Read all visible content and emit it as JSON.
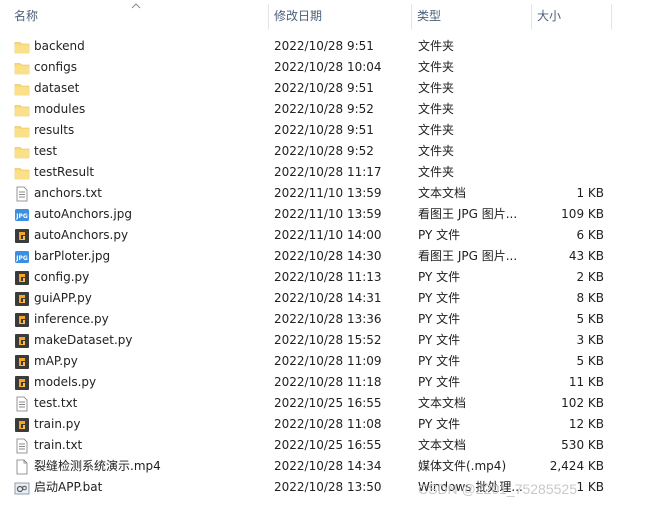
{
  "columns": {
    "name": "名称",
    "date": "修改日期",
    "type": "类型",
    "size": "大小"
  },
  "files": [
    {
      "name": "backend",
      "date": "2022/10/28 9:51",
      "type": "文件夹",
      "size": "",
      "icon": "folder-icon"
    },
    {
      "name": "configs",
      "date": "2022/10/28 10:04",
      "type": "文件夹",
      "size": "",
      "icon": "folder-icon"
    },
    {
      "name": "dataset",
      "date": "2022/10/28 9:51",
      "type": "文件夹",
      "size": "",
      "icon": "folder-icon"
    },
    {
      "name": "modules",
      "date": "2022/10/28 9:52",
      "type": "文件夹",
      "size": "",
      "icon": "folder-icon"
    },
    {
      "name": "results",
      "date": "2022/10/28 9:51",
      "type": "文件夹",
      "size": "",
      "icon": "folder-icon"
    },
    {
      "name": "test",
      "date": "2022/10/28 9:52",
      "type": "文件夹",
      "size": "",
      "icon": "folder-icon"
    },
    {
      "name": "testResult",
      "date": "2022/10/28 11:17",
      "type": "文件夹",
      "size": "",
      "icon": "folder-icon"
    },
    {
      "name": "anchors.txt",
      "date": "2022/11/10 13:59",
      "type": "文本文档",
      "size": "1 KB",
      "icon": "text-file-icon"
    },
    {
      "name": "autoAnchors.jpg",
      "date": "2022/11/10 13:59",
      "type": "看图王 JPG 图片...",
      "size": "109 KB",
      "icon": "jpg-file-icon"
    },
    {
      "name": "autoAnchors.py",
      "date": "2022/11/10 14:00",
      "type": "PY 文件",
      "size": "6 KB",
      "icon": "python-file-icon"
    },
    {
      "name": "barPloter.jpg",
      "date": "2022/10/28 14:30",
      "type": "看图王 JPG 图片...",
      "size": "43 KB",
      "icon": "jpg-file-icon"
    },
    {
      "name": "config.py",
      "date": "2022/10/28 11:13",
      "type": "PY 文件",
      "size": "2 KB",
      "icon": "python-file-icon"
    },
    {
      "name": "guiAPP.py",
      "date": "2022/10/28 14:31",
      "type": "PY 文件",
      "size": "8 KB",
      "icon": "python-file-icon"
    },
    {
      "name": "inference.py",
      "date": "2022/10/28 13:36",
      "type": "PY 文件",
      "size": "5 KB",
      "icon": "python-file-icon"
    },
    {
      "name": "makeDataset.py",
      "date": "2022/10/28 15:52",
      "type": "PY 文件",
      "size": "3 KB",
      "icon": "python-file-icon"
    },
    {
      "name": "mAP.py",
      "date": "2022/10/28 11:09",
      "type": "PY 文件",
      "size": "5 KB",
      "icon": "python-file-icon"
    },
    {
      "name": "models.py",
      "date": "2022/10/28 11:18",
      "type": "PY 文件",
      "size": "11 KB",
      "icon": "python-file-icon"
    },
    {
      "name": "test.txt",
      "date": "2022/10/25 16:55",
      "type": "文本文档",
      "size": "102 KB",
      "icon": "text-file-icon"
    },
    {
      "name": "train.py",
      "date": "2022/10/28 11:08",
      "type": "PY 文件",
      "size": "12 KB",
      "icon": "python-file-icon"
    },
    {
      "name": "train.txt",
      "date": "2022/10/25 16:55",
      "type": "文本文档",
      "size": "530 KB",
      "icon": "text-file-icon"
    },
    {
      "name": "裂缝检测系统演示.mp4",
      "date": "2022/10/28 14:34",
      "type": "媒体文件(.mp4)",
      "size": "2,424 KB",
      "icon": "video-file-icon"
    },
    {
      "name": "启动APP.bat",
      "date": "2022/10/28 13:50",
      "type": "Windows 批处理...",
      "size": "1 KB",
      "icon": "batch-file-icon"
    }
  ],
  "watermark": "CSDN @2201_75285525",
  "colors": {
    "header_text": "#4c607a",
    "folder": "#f8d775",
    "python_bg": "#3b3b3b",
    "python_accent": "#f5a623",
    "jpg_blue": "#3c8fe0"
  }
}
